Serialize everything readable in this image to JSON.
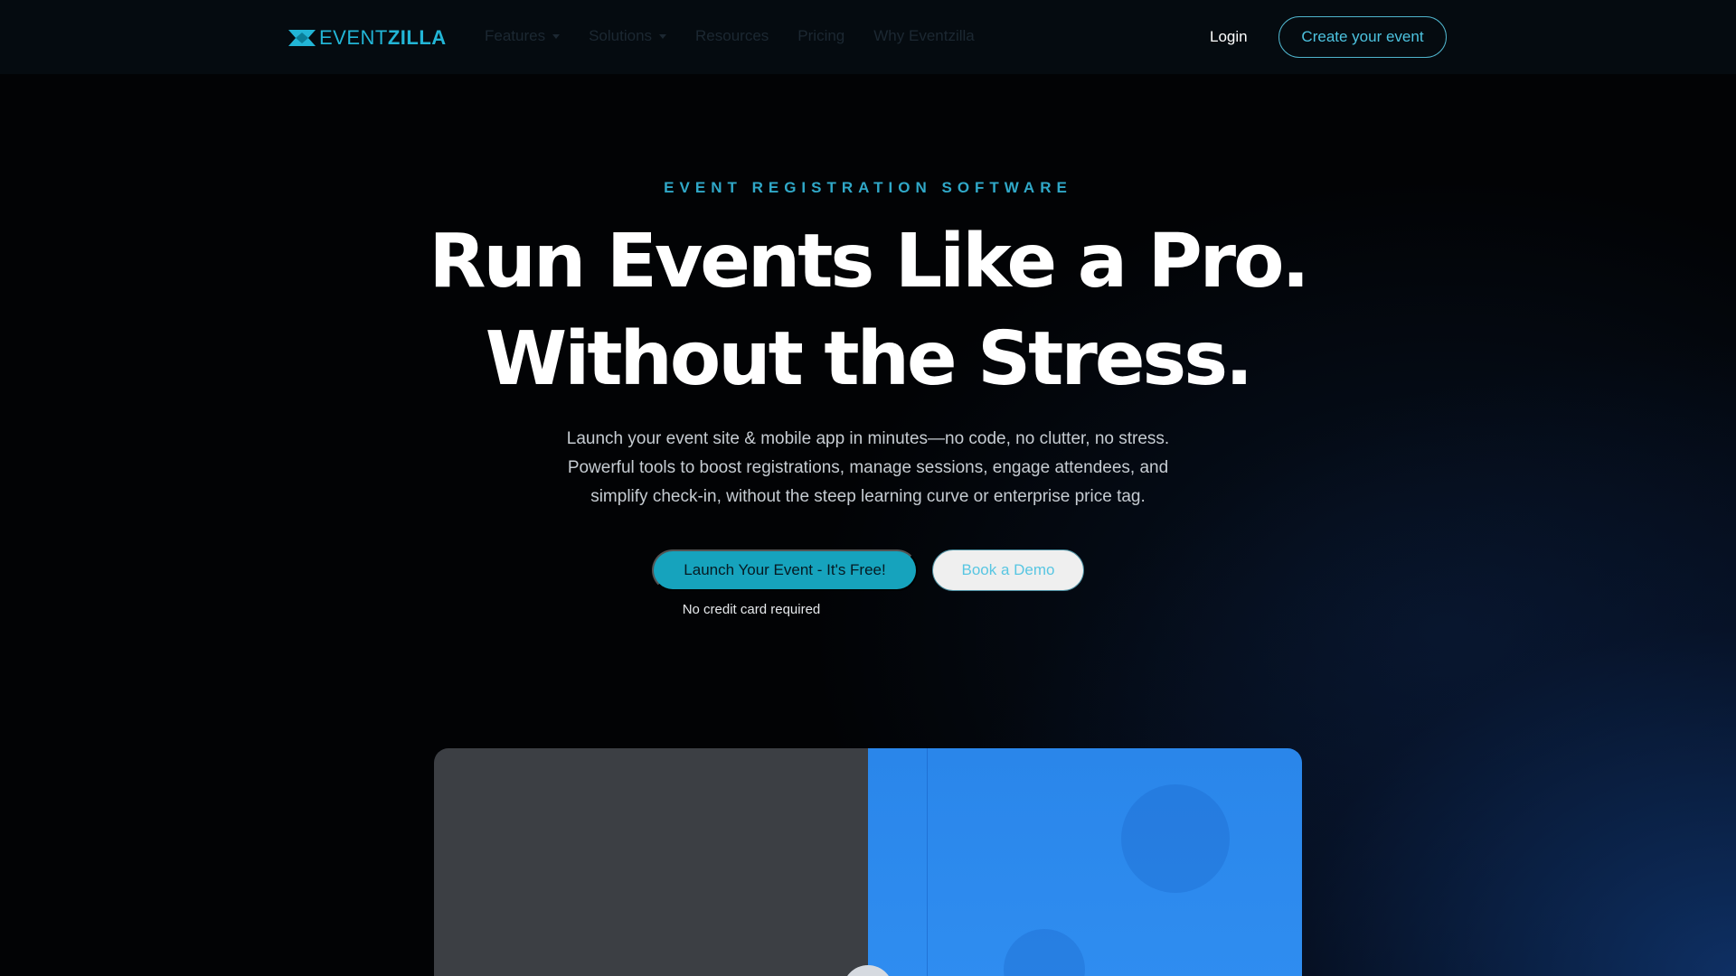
{
  "brand": {
    "logo_event": "EVENT",
    "logo_zilla": "ZILLA",
    "accent_color": "#22b5d6"
  },
  "nav": {
    "items": [
      {
        "label": "Features",
        "has_dropdown": true
      },
      {
        "label": "Solutions",
        "has_dropdown": true
      },
      {
        "label": "Resources",
        "has_dropdown": false
      },
      {
        "label": "Pricing",
        "has_dropdown": false
      },
      {
        "label": "Why Eventzilla",
        "has_dropdown": false
      }
    ],
    "login_label": "Login",
    "create_label": "Create your event"
  },
  "hero": {
    "eyebrow": "EVENT REGISTRATION SOFTWARE",
    "headline_line1": "Run Events Like a Pro.",
    "headline_line2": "Without the Stress.",
    "sub_line1": "Launch your event site & mobile app in minutes—no code, no clutter, no stress.",
    "sub_line2": "Powerful tools to boost registrations, manage sessions, engage attendees, and",
    "sub_line3": "simplify check-in, without the steep learning curve or enterprise price tag.",
    "cta_primary": "Launch Your Event - It's Free!",
    "cta_secondary": "Book a Demo",
    "note": "No credit card required"
  },
  "media": {
    "play_icon": "play-icon"
  }
}
